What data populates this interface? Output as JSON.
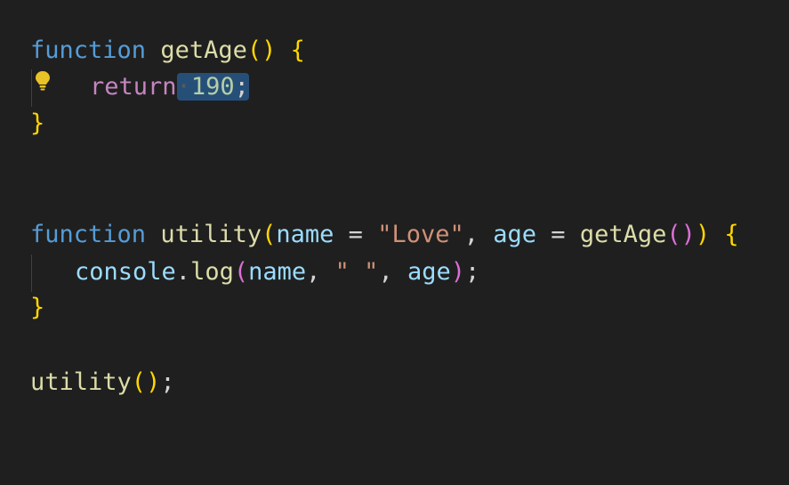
{
  "editor": {
    "language": "javascript",
    "selected_text": " 190;",
    "lightbulb_icon": "lightbulb-icon",
    "colors": {
      "background": "#1f1f1f",
      "keyword": "#569cd6",
      "control_keyword": "#c586c0",
      "function_name": "#dcdcaa",
      "parameter": "#9cdcfe",
      "string": "#ce9178",
      "number": "#b5cea8",
      "bracket_level_1": "#ffd700",
      "bracket_level_2": "#da70d6",
      "bracket_level_3": "#179fff",
      "selection": "#264f78"
    },
    "lines": {
      "l1": {
        "kw": "function",
        "fn": "getAge",
        "open_paren": "(",
        "close_paren": ")",
        "open_brace": "{"
      },
      "l2": {
        "kw": "return",
        "ws": "·",
        "num": "190",
        "semi": ";"
      },
      "l3": {
        "close_brace": "}"
      },
      "l4": {
        "kw": "function",
        "fn": "utility",
        "open_paren": "(",
        "p1": "name",
        "eq1": " = ",
        "str": "\"Love\"",
        "comma": ", ",
        "p2": "age",
        "eq2": " = ",
        "call": "getAge",
        "inner_open": "(",
        "inner_close": ")",
        "close_paren": ")",
        "open_brace": "{"
      },
      "l5": {
        "obj": "console",
        "dot": ".",
        "method": "log",
        "open_paren": "(",
        "arg1": "name",
        "comma1": ", ",
        "str": "\" \"",
        "comma2": ", ",
        "arg2": "age",
        "close_paren": ")",
        "semi": ";"
      },
      "l6": {
        "close_brace": "}"
      },
      "l7": {
        "call": "utility",
        "open_paren": "(",
        "close_paren": ")",
        "semi": ";"
      }
    }
  }
}
